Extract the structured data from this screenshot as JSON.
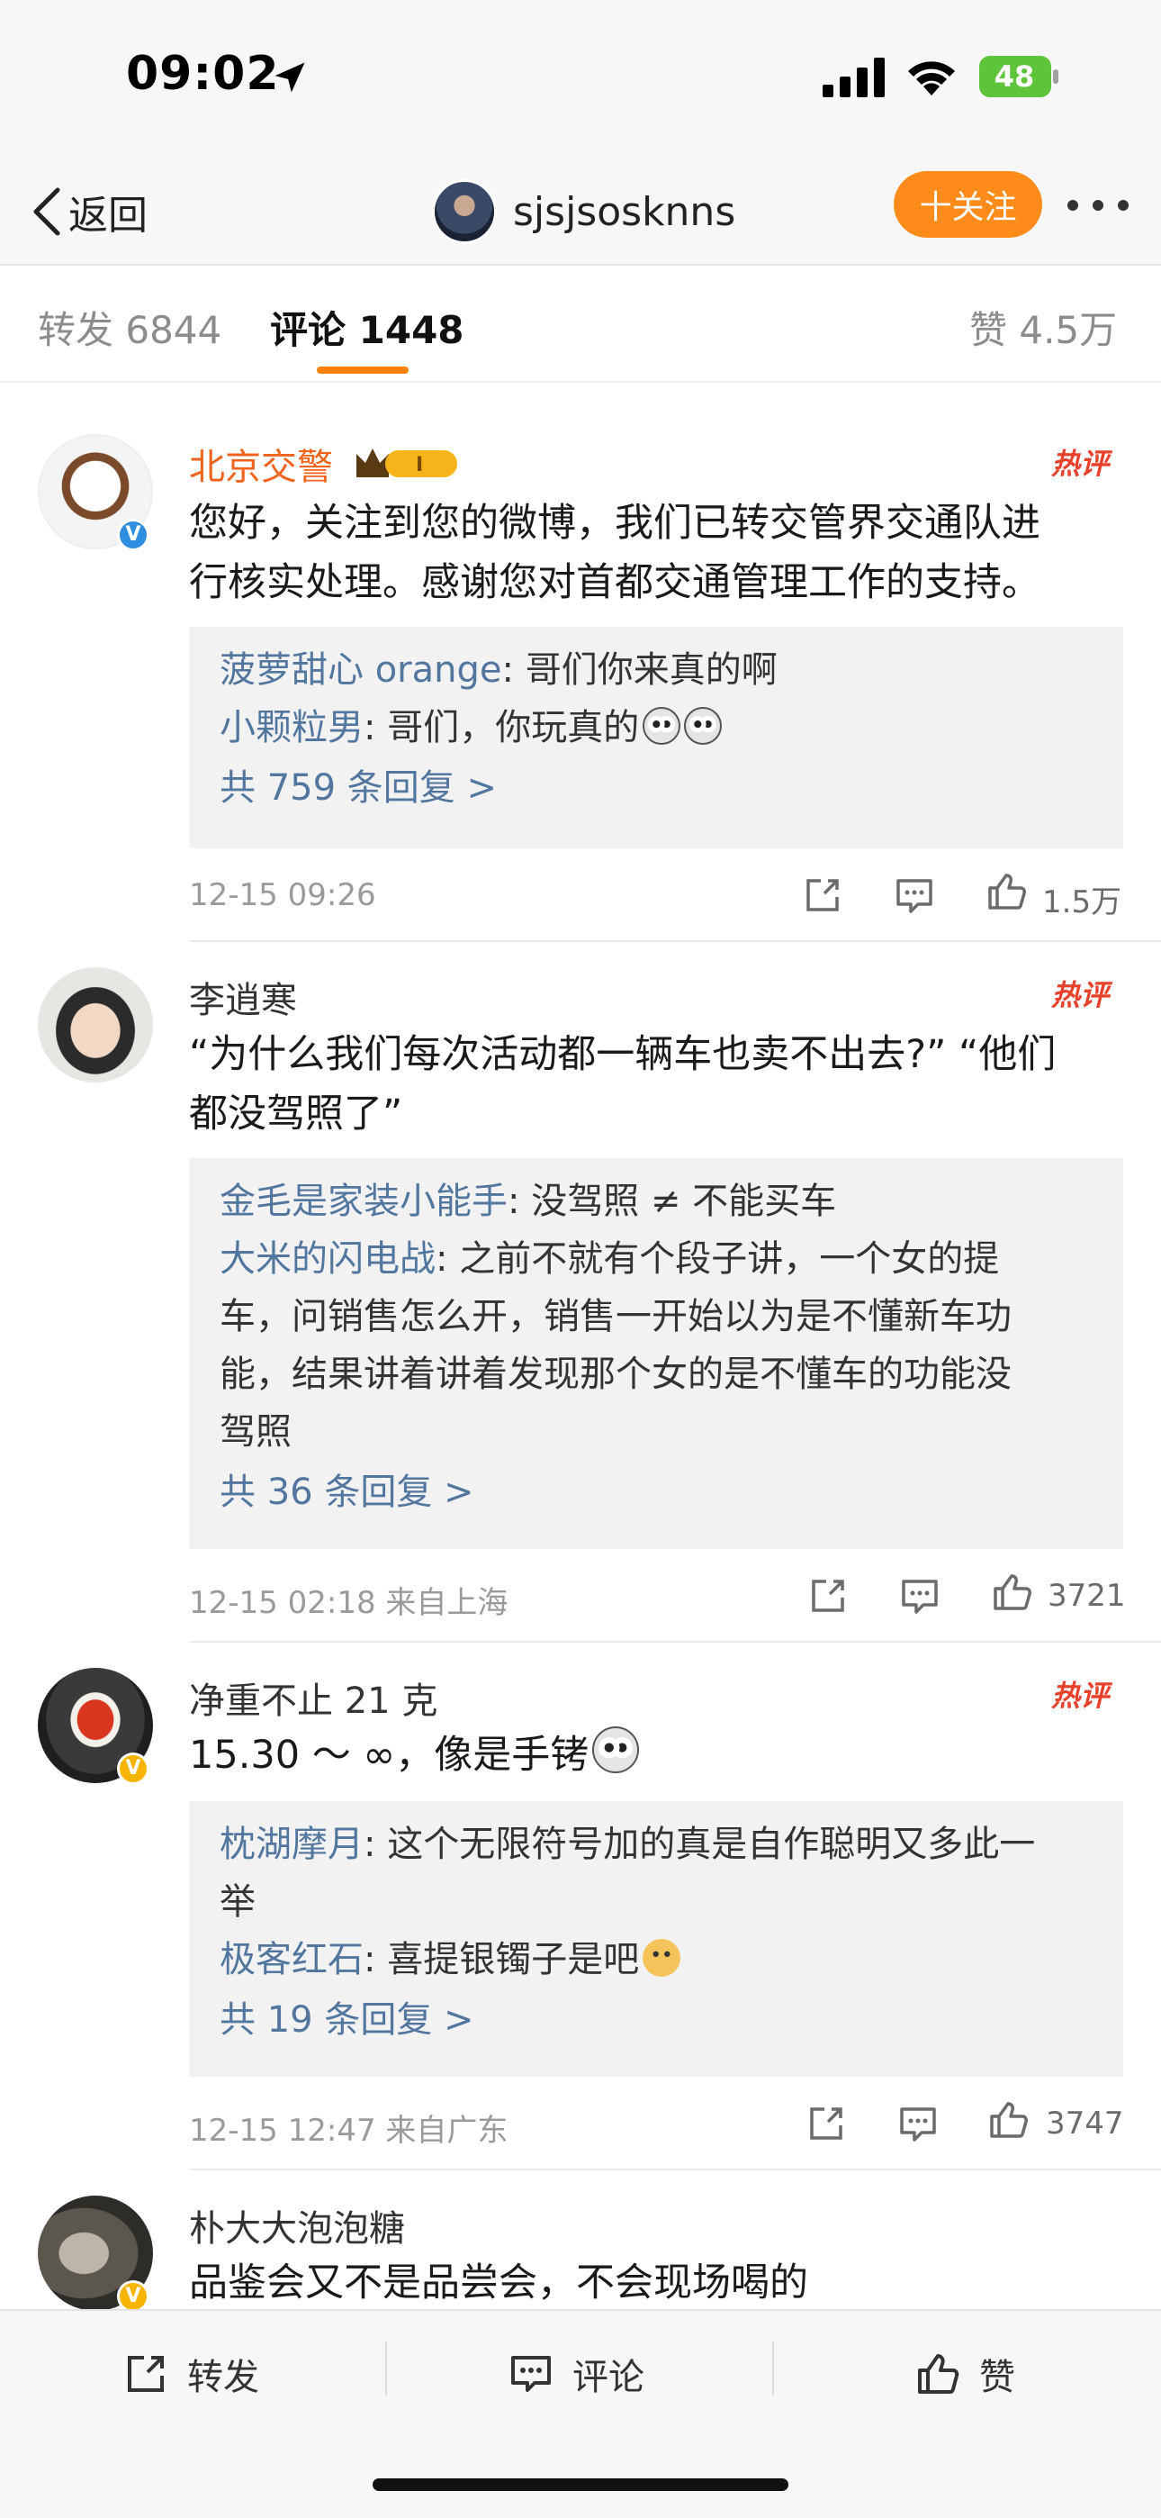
{
  "status_bar": {
    "time": "09:02",
    "battery": "48"
  },
  "nav": {
    "back_label": "返回",
    "username": "sjsjsosknns",
    "follow_label": "十关注"
  },
  "tabs": {
    "repost": "转发 6844",
    "comment": "评论 1448",
    "like": "赞 4.5万"
  },
  "comments": [
    {
      "name": "北京交警",
      "hot_label": "热评",
      "text_lines": [
        "您好，关注到您的微博，我们已转交管界交通队进",
        "行核实处理。感谢您对首都交通管理工作的支持。"
      ],
      "replies": [
        {
          "user": "菠萝甜心 orange",
          "text": ": 哥们你来真的啊"
        },
        {
          "user": "小颗粒男",
          "text": ": 哥们，你玩真的"
        }
      ],
      "reply_more": "共 759 条回复 >",
      "time": "12-15 09:26",
      "likes": "1.5万"
    },
    {
      "name": "李逍寒",
      "hot_label": "热评",
      "text_lines": [
        "“为什么我们每次活动都一辆车也卖不出去?” “他们",
        "都没驾照了”"
      ],
      "replies": [
        {
          "user": "金毛是家装小能手",
          "text": ": 没驾照 ≠ 不能买车"
        },
        {
          "user": "大米的闪电战",
          "text": ": 之前不就有个段子讲，一个女的提",
          "cont": [
            "车，问销售怎么开，销售一开始以为是不懂新车功",
            "能，结果讲着讲着发现那个女的是不懂车的功能没",
            "驾照"
          ]
        }
      ],
      "reply_more": "共 36 条回复 >",
      "time": "12-15 02:18  来自上海",
      "likes": "3721"
    },
    {
      "name": "净重不止 21 克",
      "hot_label": "热评",
      "text_lines": [
        "15.30 ～ ∞，像是手铐"
      ],
      "replies": [
        {
          "user": "枕湖摩月",
          "text": ": 这个无限符号加的真是自作聪明又多此一",
          "cont": [
            "举"
          ]
        },
        {
          "user": "极客红石",
          "text": ": 喜提银镯子是吧"
        }
      ],
      "reply_more": "共 19 条回复 >",
      "time": "12-15 12:47  来自广东",
      "likes": "3747"
    },
    {
      "name": "朴大大泡泡糖",
      "text_lines": [
        "品鉴会又不是品尝会，不会现场喝的"
      ]
    }
  ],
  "bottom_bar": {
    "repost": "转发",
    "comment": "评论",
    "like": "赞"
  }
}
